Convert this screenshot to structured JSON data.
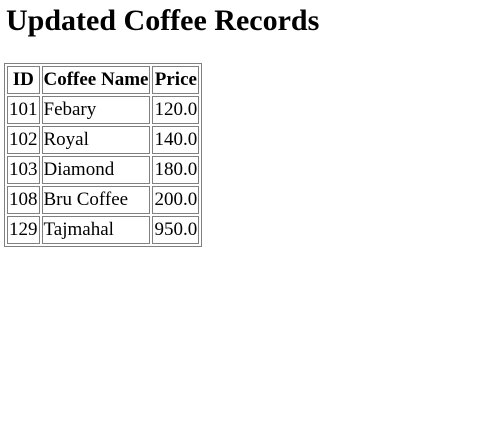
{
  "page": {
    "title": "Updated Coffee Records"
  },
  "table": {
    "headers": [
      "ID",
      "Coffee Name",
      "Price"
    ],
    "rows": [
      [
        "101",
        "Febary",
        "120.0"
      ],
      [
        "102",
        "Royal",
        "140.0"
      ],
      [
        "103",
        "Diamond",
        "180.0"
      ],
      [
        "108",
        "Bru Coffee",
        "200.0"
      ],
      [
        "129",
        "Tajmahal",
        "950.0"
      ]
    ]
  }
}
